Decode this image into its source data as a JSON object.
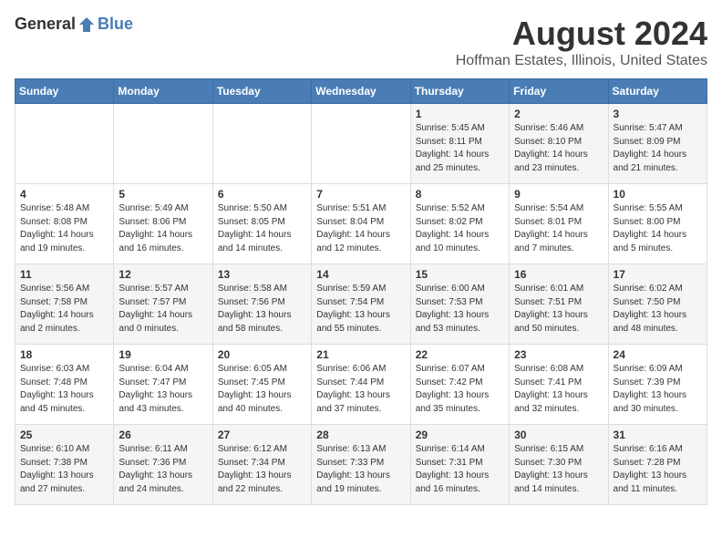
{
  "header": {
    "logo_general": "General",
    "logo_blue": "Blue",
    "month_title": "August 2024",
    "location": "Hoffman Estates, Illinois, United States"
  },
  "days_of_week": [
    "Sunday",
    "Monday",
    "Tuesday",
    "Wednesday",
    "Thursday",
    "Friday",
    "Saturday"
  ],
  "weeks": [
    [
      {
        "day": "",
        "info": ""
      },
      {
        "day": "",
        "info": ""
      },
      {
        "day": "",
        "info": ""
      },
      {
        "day": "",
        "info": ""
      },
      {
        "day": "1",
        "info": "Sunrise: 5:45 AM\nSunset: 8:11 PM\nDaylight: 14 hours\nand 25 minutes."
      },
      {
        "day": "2",
        "info": "Sunrise: 5:46 AM\nSunset: 8:10 PM\nDaylight: 14 hours\nand 23 minutes."
      },
      {
        "day": "3",
        "info": "Sunrise: 5:47 AM\nSunset: 8:09 PM\nDaylight: 14 hours\nand 21 minutes."
      }
    ],
    [
      {
        "day": "4",
        "info": "Sunrise: 5:48 AM\nSunset: 8:08 PM\nDaylight: 14 hours\nand 19 minutes."
      },
      {
        "day": "5",
        "info": "Sunrise: 5:49 AM\nSunset: 8:06 PM\nDaylight: 14 hours\nand 16 minutes."
      },
      {
        "day": "6",
        "info": "Sunrise: 5:50 AM\nSunset: 8:05 PM\nDaylight: 14 hours\nand 14 minutes."
      },
      {
        "day": "7",
        "info": "Sunrise: 5:51 AM\nSunset: 8:04 PM\nDaylight: 14 hours\nand 12 minutes."
      },
      {
        "day": "8",
        "info": "Sunrise: 5:52 AM\nSunset: 8:02 PM\nDaylight: 14 hours\nand 10 minutes."
      },
      {
        "day": "9",
        "info": "Sunrise: 5:54 AM\nSunset: 8:01 PM\nDaylight: 14 hours\nand 7 minutes."
      },
      {
        "day": "10",
        "info": "Sunrise: 5:55 AM\nSunset: 8:00 PM\nDaylight: 14 hours\nand 5 minutes."
      }
    ],
    [
      {
        "day": "11",
        "info": "Sunrise: 5:56 AM\nSunset: 7:58 PM\nDaylight: 14 hours\nand 2 minutes."
      },
      {
        "day": "12",
        "info": "Sunrise: 5:57 AM\nSunset: 7:57 PM\nDaylight: 14 hours\nand 0 minutes."
      },
      {
        "day": "13",
        "info": "Sunrise: 5:58 AM\nSunset: 7:56 PM\nDaylight: 13 hours\nand 58 minutes."
      },
      {
        "day": "14",
        "info": "Sunrise: 5:59 AM\nSunset: 7:54 PM\nDaylight: 13 hours\nand 55 minutes."
      },
      {
        "day": "15",
        "info": "Sunrise: 6:00 AM\nSunset: 7:53 PM\nDaylight: 13 hours\nand 53 minutes."
      },
      {
        "day": "16",
        "info": "Sunrise: 6:01 AM\nSunset: 7:51 PM\nDaylight: 13 hours\nand 50 minutes."
      },
      {
        "day": "17",
        "info": "Sunrise: 6:02 AM\nSunset: 7:50 PM\nDaylight: 13 hours\nand 48 minutes."
      }
    ],
    [
      {
        "day": "18",
        "info": "Sunrise: 6:03 AM\nSunset: 7:48 PM\nDaylight: 13 hours\nand 45 minutes."
      },
      {
        "day": "19",
        "info": "Sunrise: 6:04 AM\nSunset: 7:47 PM\nDaylight: 13 hours\nand 43 minutes."
      },
      {
        "day": "20",
        "info": "Sunrise: 6:05 AM\nSunset: 7:45 PM\nDaylight: 13 hours\nand 40 minutes."
      },
      {
        "day": "21",
        "info": "Sunrise: 6:06 AM\nSunset: 7:44 PM\nDaylight: 13 hours\nand 37 minutes."
      },
      {
        "day": "22",
        "info": "Sunrise: 6:07 AM\nSunset: 7:42 PM\nDaylight: 13 hours\nand 35 minutes."
      },
      {
        "day": "23",
        "info": "Sunrise: 6:08 AM\nSunset: 7:41 PM\nDaylight: 13 hours\nand 32 minutes."
      },
      {
        "day": "24",
        "info": "Sunrise: 6:09 AM\nSunset: 7:39 PM\nDaylight: 13 hours\nand 30 minutes."
      }
    ],
    [
      {
        "day": "25",
        "info": "Sunrise: 6:10 AM\nSunset: 7:38 PM\nDaylight: 13 hours\nand 27 minutes."
      },
      {
        "day": "26",
        "info": "Sunrise: 6:11 AM\nSunset: 7:36 PM\nDaylight: 13 hours\nand 24 minutes."
      },
      {
        "day": "27",
        "info": "Sunrise: 6:12 AM\nSunset: 7:34 PM\nDaylight: 13 hours\nand 22 minutes."
      },
      {
        "day": "28",
        "info": "Sunrise: 6:13 AM\nSunset: 7:33 PM\nDaylight: 13 hours\nand 19 minutes."
      },
      {
        "day": "29",
        "info": "Sunrise: 6:14 AM\nSunset: 7:31 PM\nDaylight: 13 hours\nand 16 minutes."
      },
      {
        "day": "30",
        "info": "Sunrise: 6:15 AM\nSunset: 7:30 PM\nDaylight: 13 hours\nand 14 minutes."
      },
      {
        "day": "31",
        "info": "Sunrise: 6:16 AM\nSunset: 7:28 PM\nDaylight: 13 hours\nand 11 minutes."
      }
    ]
  ]
}
